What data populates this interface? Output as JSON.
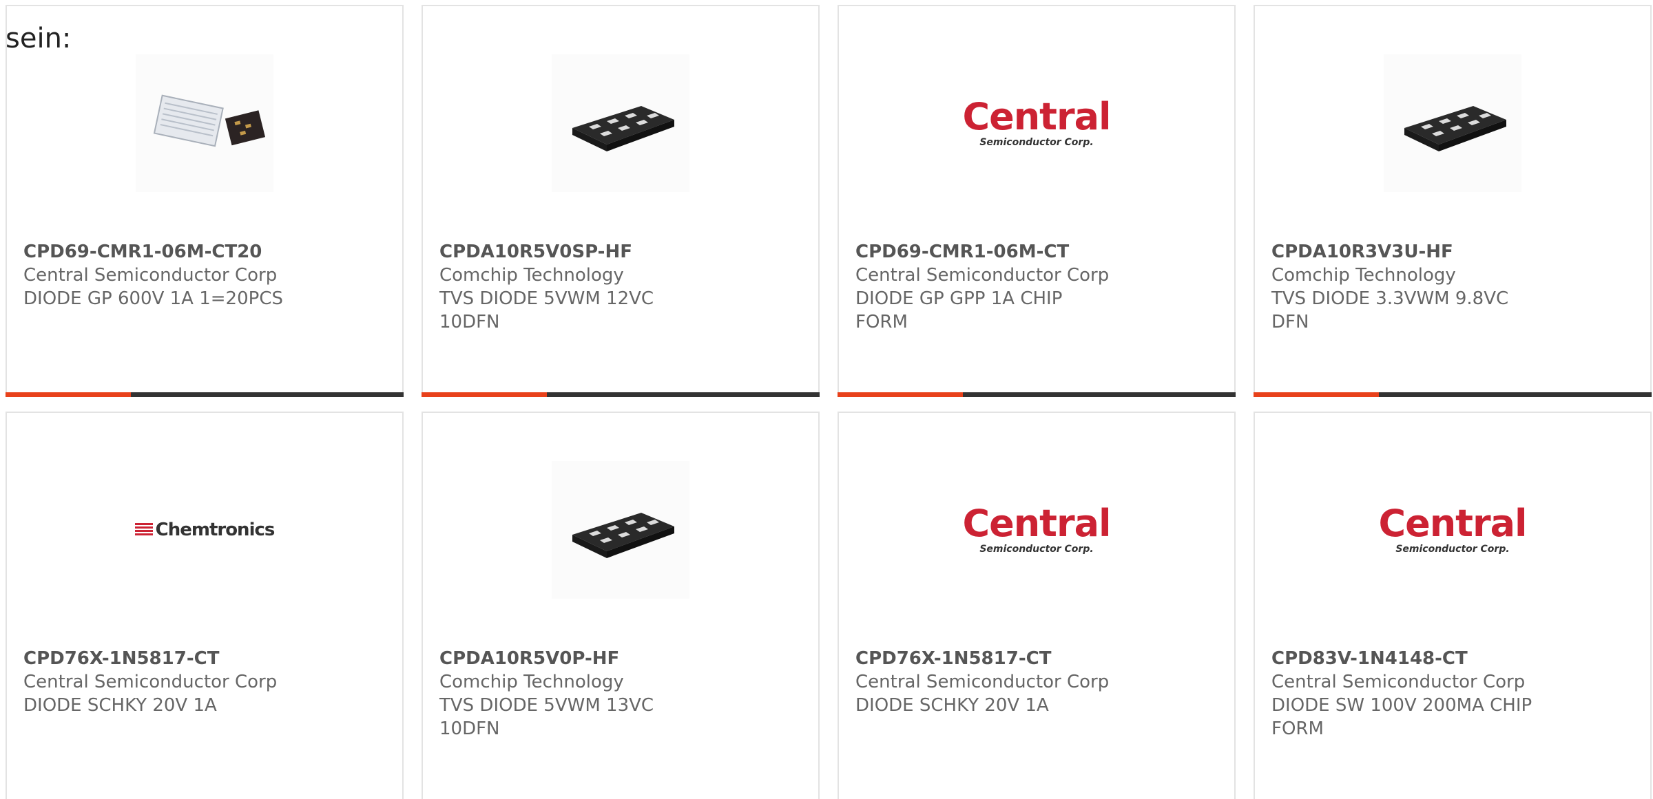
{
  "intro": {
    "text": "sein:"
  },
  "colors": {
    "accent": "#e8411b",
    "bar": "#333333",
    "border": "#e3e3e3",
    "text": "#666666"
  },
  "products": [
    {
      "part": "CPD69-CMR1-06M-CT20",
      "manufacturer": "Central Semiconductor Corp",
      "description": "DIODE GP 600V 1A 1=20PCS",
      "image": "chip-tray-photo"
    },
    {
      "part": "CPDA10R5V0SP-HF",
      "manufacturer": "Comchip Technology",
      "description": "TVS DIODE 5VWM 12VC 10DFN",
      "image": "dfn-package-photo"
    },
    {
      "part": "CPD69-CMR1-06M-CT",
      "manufacturer": "Central Semiconductor Corp",
      "description": "DIODE GP GPP 1A CHIP FORM",
      "image": "central-logo"
    },
    {
      "part": "CPDA10R3V3U-HF",
      "manufacturer": "Comchip Technology",
      "description": "TVS DIODE 3.3VWM 9.8VC DFN",
      "image": "dfn-package-photo"
    },
    {
      "part": "CPD76X-1N5817-CT",
      "manufacturer": "Central Semiconductor Corp",
      "description": "DIODE SCHKY 20V 1A",
      "image": "chemtronics-logo"
    },
    {
      "part": "CPDA10R5V0P-HF",
      "manufacturer": "Comchip Technology",
      "description": "TVS DIODE 5VWM 13VC 10DFN",
      "image": "dfn-package-photo"
    },
    {
      "part": "CPD76X-1N5817-CT",
      "manufacturer": "Central Semiconductor Corp",
      "description": "DIODE SCHKY 20V 1A",
      "image": "central-logo"
    },
    {
      "part": "CPD83V-1N4148-CT",
      "manufacturer": "Central Semiconductor Corp",
      "description": "DIODE SW 100V 200MA CHIP FORM",
      "image": "central-logo"
    }
  ],
  "logos": {
    "central_big": "Central",
    "central_small": "Semiconductor Corp.",
    "chemtronics": "Chemtronics"
  }
}
